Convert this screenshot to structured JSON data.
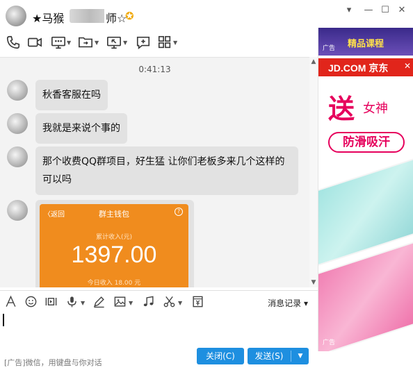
{
  "window": {
    "title": "★马猴",
    "title_suffix": "师☆",
    "minimize": "—",
    "maximize": "☐",
    "close": "✕",
    "collapse": "▾"
  },
  "chat": {
    "timestamp": "0:41:13",
    "messages": [
      {
        "text": "秋香客服在吗"
      },
      {
        "text": "我就是来说个事的"
      },
      {
        "text": "那个收费QQ群项目，好生猛  让你们老板多来几个这样的可以吗"
      }
    ],
    "wallet": {
      "back": "〈返回",
      "title": "群主钱包",
      "help": "?",
      "subtitle": "累计收入(元)",
      "amount": "1397.00",
      "today": "今日收入 18.00 元"
    }
  },
  "input": {
    "history_label": "消息记录 ▾"
  },
  "bottom": {
    "ad_text": "[广告]微信，用键盘与你对话",
    "close_label": "关闭(C)",
    "send_label": "发送(S)",
    "send_dropdown": "▼"
  },
  "ad": {
    "top_label": "广告",
    "top_title": "精品课程",
    "jd_logo": "JD.COM 京东",
    "jd_close": "✕",
    "gift": "送",
    "goddess": "女神",
    "slogan": "防滑吸汗",
    "bottom_label": "广告"
  }
}
